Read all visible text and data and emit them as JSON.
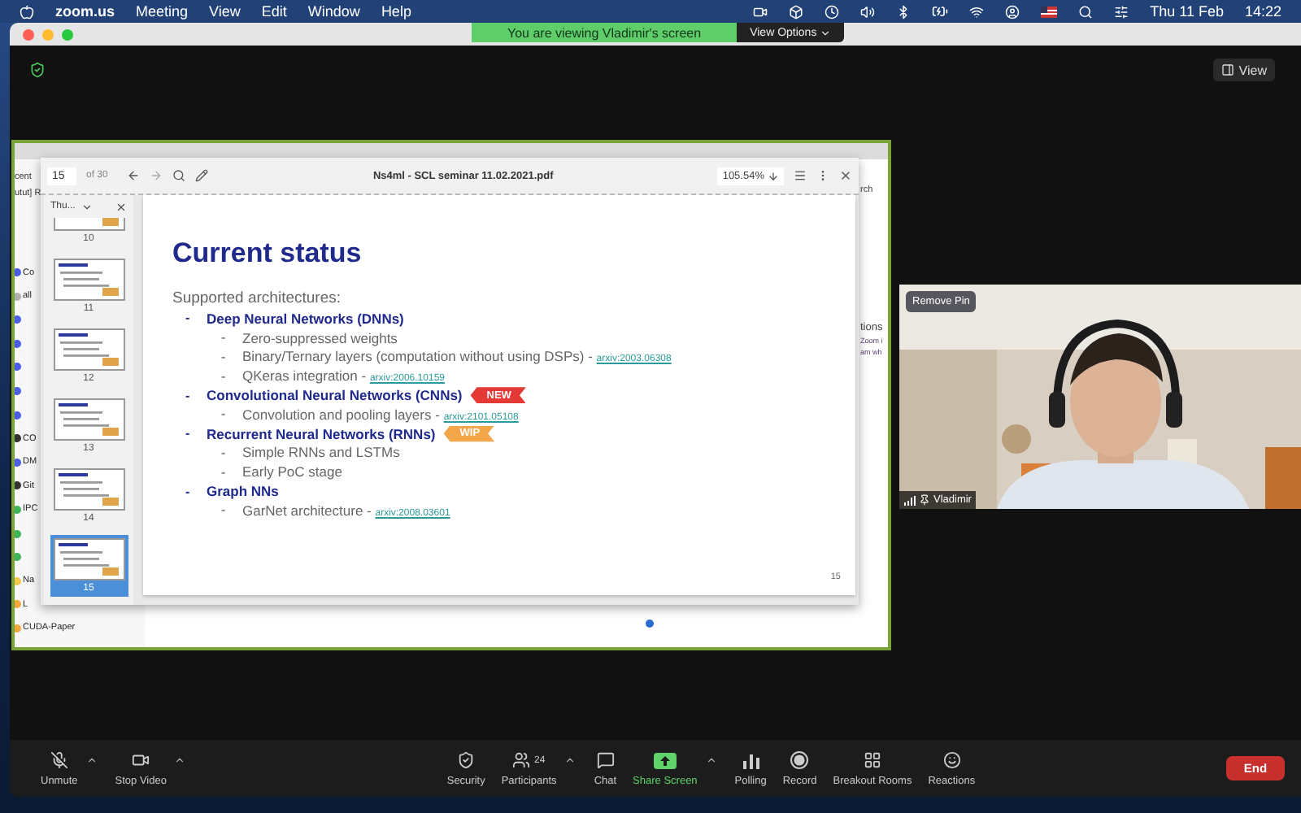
{
  "menu_bar": {
    "app": "zoom.us",
    "menus": [
      "Meeting",
      "View",
      "Edit",
      "Window",
      "Help"
    ],
    "date": "Thu 11 Feb",
    "time": "14:22"
  },
  "banner": {
    "text": "You are viewing Vladimir's screen",
    "options": "View Options"
  },
  "view_button": "View",
  "shared_screen": {
    "background_app": {
      "top_texts": [
        "cent",
        "utut] R"
      ],
      "sidebar": [
        {
          "label": "Co",
          "color": "#4a5ee8"
        },
        {
          "label": "all",
          "color": "#b0b0b0"
        },
        {
          "color": "#4a5ee8"
        },
        {
          "color": "#4a5ee8"
        },
        {
          "color": "#4a5ee8"
        },
        {
          "color": "#4a5ee8"
        },
        {
          "color": "#4a5ee8"
        },
        {
          "label": "CO",
          "color": "#333333"
        },
        {
          "label": "DM",
          "color": "#4a5ee8"
        },
        {
          "label": "Git",
          "color": "#333333"
        },
        {
          "label": "IPC",
          "color": "#3fb55a"
        },
        {
          "color": "#3fb55a"
        },
        {
          "color": "#3fb55a"
        },
        {
          "label": "Na",
          "color": "#f2c94c"
        },
        {
          "label": "L",
          "color": "#f2a93b"
        },
        {
          "label": "CUDA-Paper",
          "color": "#f2a93b"
        }
      ],
      "fragments": [
        {
          "kind": "search",
          "text": "rch"
        },
        {
          "kind": "heading",
          "text": "tions"
        },
        {
          "kind": "small",
          "text": "Zoom i"
        },
        {
          "kind": "small",
          "text": "am wh"
        }
      ]
    },
    "pdf": {
      "page": "15",
      "page_count": "of 30",
      "title": "Ns4ml - SCL seminar 11.02.2021.pdf",
      "zoom": "105.54%",
      "thumbnail_panel": "Thu...",
      "thumbnails": [
        {
          "number": "10",
          "selected": false
        },
        {
          "number": "11",
          "selected": false
        },
        {
          "number": "12",
          "selected": false
        },
        {
          "number": "13",
          "selected": false
        },
        {
          "number": "14",
          "selected": false
        },
        {
          "number": "15",
          "selected": true
        }
      ],
      "slide": {
        "title": "Current status",
        "intro": "Supported architectures:",
        "page_number": "15",
        "items": [
          {
            "marker": "-",
            "text": "Deep Neural Networks (DNNs)",
            "children": [
              {
                "marker": "-",
                "text": "Zero-suppressed weights"
              },
              {
                "marker": "-",
                "text": "Binary/Ternary layers (computation without using DSPs) -",
                "link": "arxiv:2003.06308"
              },
              {
                "marker": "-",
                "text": "QKeras integration -",
                "link": "arxiv:2006.10159"
              }
            ]
          },
          {
            "marker": "-",
            "text": "Convolutional Neural Networks (CNNs)",
            "badge": {
              "text": "NEW",
              "color": "#e53935"
            },
            "children": [
              {
                "marker": "-",
                "text": "Convolution and pooling layers -",
                "link": "arxiv:2101.05108"
              }
            ]
          },
          {
            "marker": "-",
            "text": "Recurrent Neural Networks (RNNs)",
            "badge": {
              "text": "WIP",
              "color": "#f4a64a"
            },
            "children": [
              {
                "marker": "-",
                "text": "Simple RNNs and LSTMs"
              },
              {
                "marker": "-",
                "text": "Early PoC stage"
              }
            ]
          },
          {
            "marker": "-",
            "text": "Graph NNs",
            "children": [
              {
                "marker": "-",
                "text": "GarNet architecture -",
                "link": "arxiv:2008.03601"
              }
            ]
          }
        ]
      }
    }
  },
  "video": {
    "name": "Vladimir",
    "pin_button": "Remove Pin"
  },
  "toolbar": [
    {
      "kind": "mic_off",
      "label": "Unmute",
      "caret": true,
      "highlighted": false
    },
    {
      "kind": "video",
      "label": "Stop Video",
      "caret": true,
      "highlighted": false
    },
    {
      "kind": "security",
      "label": "Security",
      "caret": false,
      "highlighted": false
    },
    {
      "kind": "participants",
      "label": "Participants",
      "count": "24",
      "caret": true,
      "highlighted": false
    },
    {
      "kind": "chat",
      "label": "Chat",
      "caret": false,
      "highlighted": false
    },
    {
      "kind": "share",
      "label": "Share Screen",
      "caret": true,
      "highlighted": true
    },
    {
      "kind": "polling",
      "label": "Polling",
      "caret": false,
      "highlighted": false
    },
    {
      "kind": "record",
      "label": "Record",
      "caret": false,
      "highlighted": false
    },
    {
      "kind": "breakout",
      "label": "Breakout Rooms",
      "caret": false,
      "highlighted": false
    },
    {
      "kind": "reactions",
      "label": "Reactions",
      "caret": false,
      "highlighted": false
    }
  ],
  "end_button": "End"
}
